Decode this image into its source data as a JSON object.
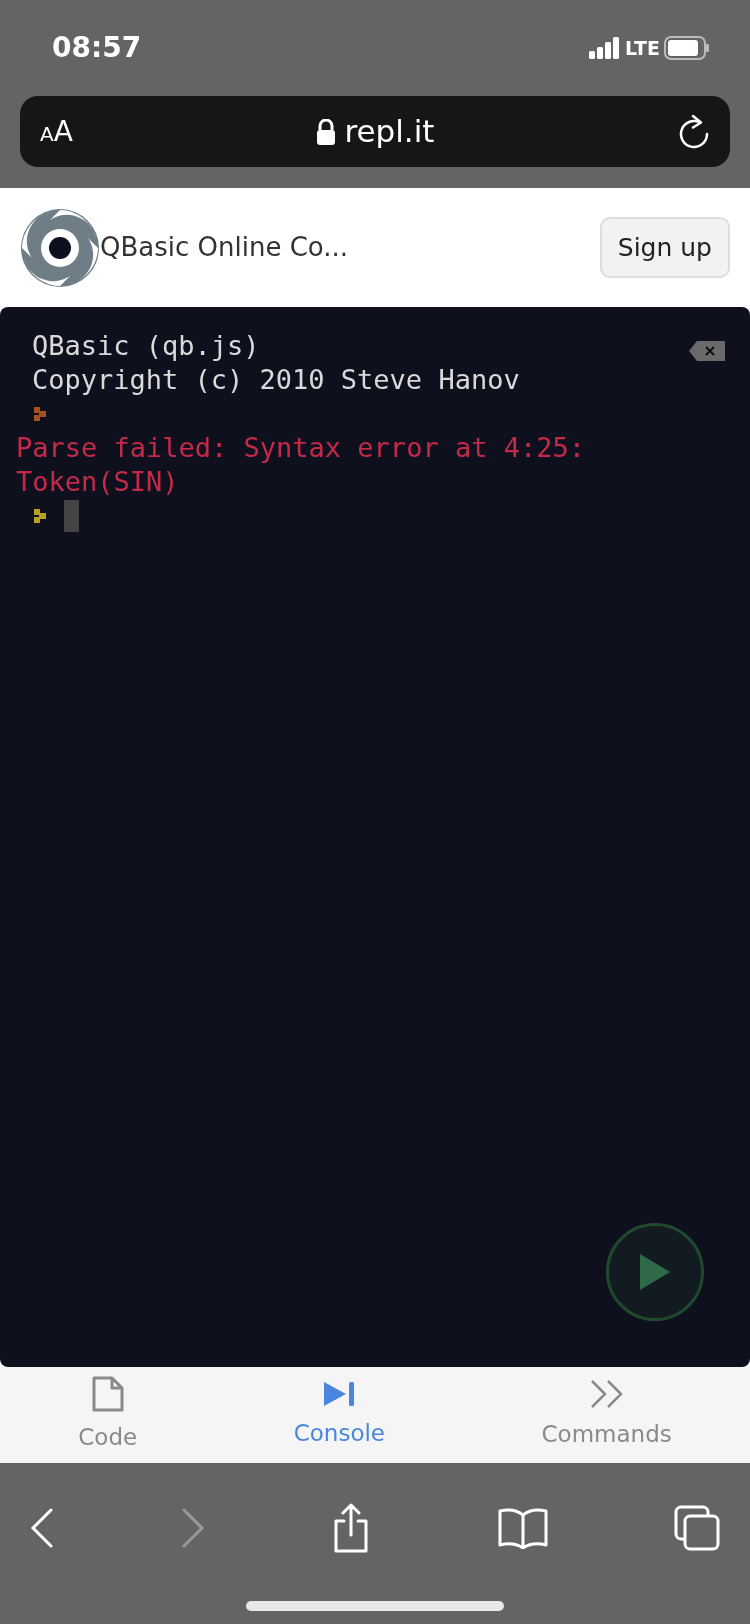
{
  "status_bar": {
    "time": "08:57",
    "network": "LTE"
  },
  "address_bar": {
    "text_size": "AA",
    "url": "repl.it"
  },
  "header": {
    "title": "QBasic Online Co...",
    "sign_up": "Sign up"
  },
  "console": {
    "lines": [
      {
        "kind": "text",
        "text": "QBasic (qb.js)"
      },
      {
        "kind": "text",
        "text": "Copyright (c) 2010 Steve Hanov"
      },
      {
        "kind": "prompt",
        "color": "#a8501e"
      },
      {
        "kind": "error",
        "text": "Parse failed: Syntax error at 4:25: Token(SIN)"
      },
      {
        "kind": "input",
        "color": "#b8a020"
      }
    ]
  },
  "tabs": [
    {
      "label": "Code",
      "selected": false
    },
    {
      "label": "Console",
      "selected": true
    },
    {
      "label": "Commands",
      "selected": false
    }
  ],
  "toolbar": {
    "back_disabled": false,
    "forward_disabled": true
  }
}
